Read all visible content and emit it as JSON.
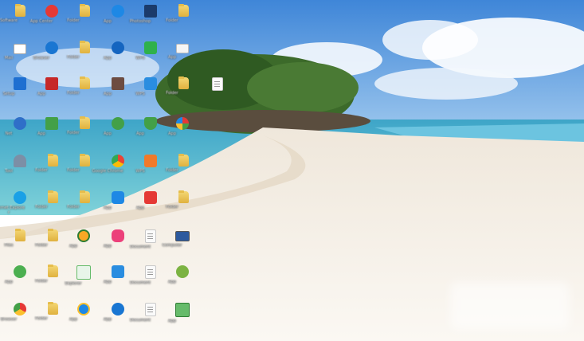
{
  "desktop": {
    "columns": [
      [
        {
          "icon": "folder-icon",
          "label": "Software"
        },
        {
          "icon": "mail-icon",
          "label": "Mail"
        },
        {
          "icon": "program-icon",
          "label": "Setup"
        },
        {
          "icon": "network-icon",
          "label": "Net"
        },
        {
          "icon": "tool-icon",
          "label": "Tool"
        },
        {
          "icon": "ie-icon",
          "label": "Internet Explorer"
        },
        {
          "icon": "folder-icon",
          "label": "Files"
        },
        {
          "icon": "app-icon",
          "label": "App"
        },
        {
          "icon": "browser-icon",
          "label": "Browser"
        }
      ],
      [
        {
          "icon": "app-icon",
          "label": "App Center"
        },
        {
          "icon": "globe-icon",
          "label": "Browser"
        },
        {
          "icon": "app-icon",
          "label": "App"
        },
        {
          "icon": "app-icon",
          "label": "App"
        },
        {
          "icon": "folder-icon",
          "label": "Folder"
        },
        {
          "icon": "folder-icon",
          "label": "Folder"
        },
        {
          "icon": "folder-icon",
          "label": "Folder"
        },
        {
          "icon": "folder-icon",
          "label": "Folder"
        },
        {
          "icon": "folder-icon",
          "label": "Folder"
        }
      ],
      [
        {
          "icon": "folder-icon",
          "label": "Folder"
        },
        {
          "icon": "folder-icon",
          "label": "Folder"
        },
        {
          "icon": "folder-icon",
          "label": "Folder"
        },
        {
          "icon": "folder-icon",
          "label": "Folder"
        },
        {
          "icon": "folder-icon",
          "label": "Folder"
        },
        {
          "icon": "folder-icon",
          "label": "Folder"
        },
        {
          "icon": "app-icon",
          "label": "App"
        },
        {
          "icon": "app-icon",
          "label": "Explorer"
        },
        {
          "icon": "app-icon",
          "label": "App"
        }
      ],
      [
        {
          "icon": "app-icon",
          "label": "App"
        },
        {
          "icon": "app-icon",
          "label": "App"
        },
        {
          "icon": "app-icon",
          "label": "App"
        },
        {
          "icon": "app-icon",
          "label": "App"
        },
        {
          "icon": "chrome-icon",
          "label": "Google Chrome"
        },
        {
          "icon": "app-icon",
          "label": "App"
        },
        {
          "icon": "app-icon",
          "label": "App"
        },
        {
          "icon": "app-icon",
          "label": "App"
        },
        {
          "icon": "app-icon",
          "label": "App"
        }
      ],
      [
        {
          "icon": "app-icon",
          "label": "Photoshop"
        },
        {
          "icon": "app-icon",
          "label": "WPS"
        },
        {
          "icon": "app-icon",
          "label": "WPS"
        },
        {
          "icon": "app-icon",
          "label": "App"
        },
        {
          "icon": "app-icon",
          "label": "WPS"
        },
        {
          "icon": "app-icon",
          "label": "App"
        },
        {
          "icon": "doc-icon",
          "label": "Document"
        },
        {
          "icon": "doc-icon",
          "label": "Document"
        },
        {
          "icon": "doc-icon",
          "label": "Document"
        }
      ],
      [
        {
          "icon": "folder-icon",
          "label": "Folder"
        },
        {
          "icon": "app-icon",
          "label": "App"
        },
        {
          "icon": "folder-icon",
          "label": "Folder"
        },
        {
          "icon": "app-icon",
          "label": "App"
        },
        {
          "icon": "folder-icon",
          "label": "Folder"
        },
        {
          "icon": "folder-icon",
          "label": "Folder"
        },
        {
          "icon": "monitor-icon",
          "label": "Computer"
        },
        {
          "icon": "app-icon",
          "label": "App"
        },
        {
          "icon": "app-icon",
          "label": "App"
        }
      ]
    ]
  }
}
